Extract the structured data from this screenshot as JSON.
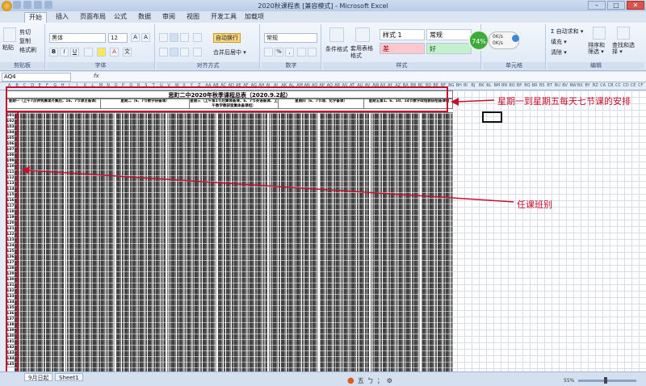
{
  "window": {
    "title": "2020秋课程表  [兼容模式] - Microsoft Excel",
    "min": "–",
    "max": "□",
    "close": "✕"
  },
  "tabs": [
    "开始",
    "插入",
    "页面布局",
    "公式",
    "数据",
    "审阅",
    "视图",
    "开发工具",
    "加载项"
  ],
  "ribbon": {
    "clipboard": {
      "paste": "粘贴",
      "cut": "剪切",
      "copy": "复制",
      "format_painter": "格式刷",
      "label": "剪贴板"
    },
    "font": {
      "name": "黑体",
      "size": "12",
      "label": "字体",
      "bold": "B",
      "italic": "I",
      "underline": "U",
      "grow": "A",
      "shrink": "A",
      "font_color": "A",
      "wen": "文"
    },
    "alignment": {
      "wrap": "自动换行",
      "merge": "合并后居中 ▾",
      "label": "对齐方式"
    },
    "number": {
      "format": "常规",
      "percent": "%",
      "comma": ",",
      "label": "数字"
    },
    "styles": {
      "conditional": "条件格式",
      "table": "套用表格格式",
      "style1": "样式 1",
      "normal": "常规",
      "bad": "差",
      "good": "好",
      "label": "样式"
    },
    "cells": {
      "label": "单元格"
    },
    "editing": {
      "autosum": "Σ 自动求和 ▾",
      "fill": "填充 ▾",
      "clear": "清除 ▾",
      "sort": "排序和筛选 ▾",
      "find": "查找和选择 ▾",
      "label": "编辑"
    },
    "net_badge": {
      "percent": "74%",
      "up": "0K/s",
      "down": "0K/s"
    }
  },
  "formula_bar": {
    "cell_ref": "AQ4",
    "fx": "fx",
    "value": ""
  },
  "column_letters": [
    "A",
    "B",
    "C",
    "D",
    "E",
    "F",
    "G",
    "H",
    "I",
    "J",
    "K",
    "L",
    "M",
    "N",
    "O",
    "P",
    "Q",
    "R",
    "S",
    "T",
    "U",
    "V",
    "W",
    "X",
    "Y",
    "Z",
    "AA",
    "AB",
    "AC",
    "AD",
    "AE",
    "AF",
    "AG",
    "AH",
    "AI",
    "AJ",
    "AK",
    "AL",
    "AM",
    "AN",
    "AO",
    "AP",
    "AQ",
    "AR",
    "AS",
    "AT",
    "AU",
    "AV",
    "AW",
    "AX",
    "AY",
    "AZ",
    "BA",
    "BB",
    "BC",
    "BD",
    "BE",
    "BF",
    "BG",
    "BH",
    "BI",
    "BJ",
    "BK",
    "BL",
    "BM",
    "BN",
    "BO",
    "BP",
    "BQ",
    "BR",
    "BS",
    "BT",
    "BU",
    "BV",
    "BW",
    "BX",
    "BY",
    "BZ",
    "CA",
    "CB",
    "CC",
    "CD",
    "CE",
    "CF"
  ],
  "schedule": {
    "title": "思町二中2020年秋季课程总表（2020.9.2起）",
    "days": [
      "星期一（上午7点钟到晨读齐集后，16、7节课主备课）",
      "星期二（6、7节数学研备课）",
      "星期三（上午第1节后集体备课，6、7节英语备课、上午数学教研室集体备课组）",
      "星期四（6、7节理、化学备课）",
      "星期五第1、6、10、14节数学政组教研组备课组"
    ],
    "class_ids": [
      "101",
      "102",
      "103",
      "104",
      "105",
      "106",
      "107",
      "108",
      "109",
      "110",
      "111",
      "112",
      "113",
      "114",
      "115",
      "116",
      "117",
      "118",
      "119",
      "120",
      "121",
      "122",
      "123",
      "124",
      "125",
      "126",
      "127",
      "128",
      "129",
      "130",
      "131",
      "132",
      "133",
      "134",
      "135",
      "136",
      "137",
      "138",
      "139",
      "140",
      "141",
      "142",
      "143",
      "144",
      "145"
    ]
  },
  "annotations": {
    "top": "星期一到星期五每天七节课的安排",
    "left": "任课班别"
  },
  "sheet_tabs": [
    "9月日起",
    "Sheet1"
  ],
  "status": {
    "zoom": "55%",
    "ime": [
      "五",
      "ㄅ",
      "；",
      "⚙"
    ]
  }
}
